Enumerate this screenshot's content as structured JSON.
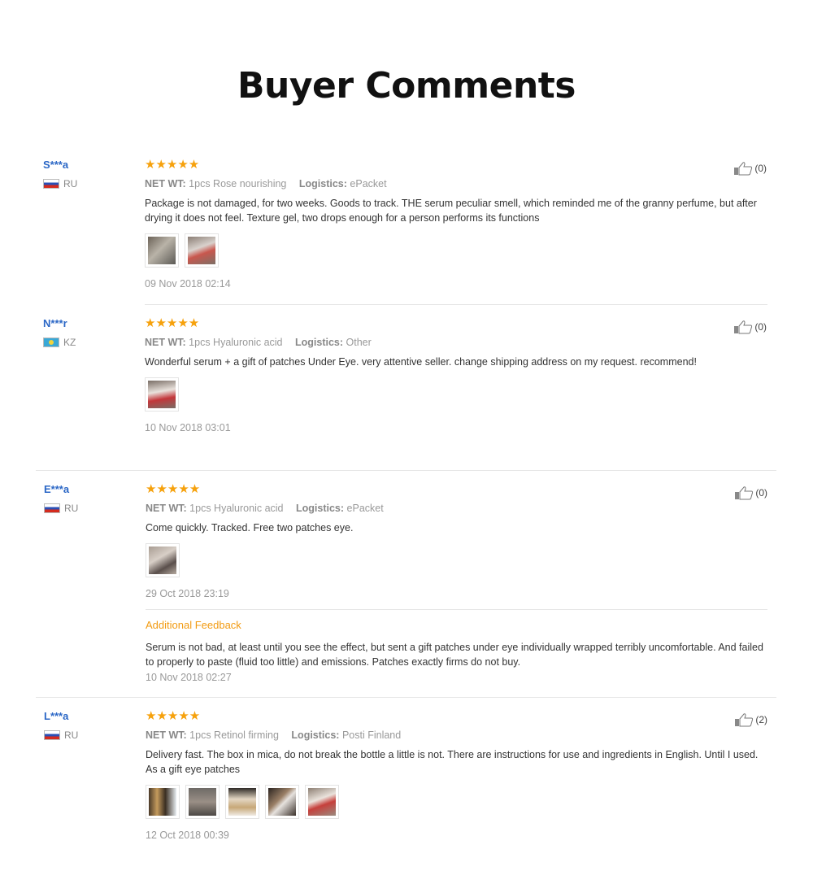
{
  "page": {
    "title": "Buyer Comments"
  },
  "reviews": [
    {
      "buyer": "S***a",
      "country": "RU",
      "stars": "★★★★★",
      "net_wt_label": "NET WT:",
      "net_wt": "1pcs Rose nourishing",
      "logistics_label": "Logistics:",
      "logistics": "ePacket",
      "text": "Package is not damaged, for two weeks. Goods to track. THE serum peculiar smell, which reminded me of the granny perfume, but after drying it does not feel. Texture gel, two drops enough for a person performs its functions",
      "likes": "(0)",
      "date": "09 Nov 2018 02:14",
      "photo_count": 2
    },
    {
      "buyer": "N***r",
      "country": "KZ",
      "stars": "★★★★★",
      "net_wt_label": "NET WT:",
      "net_wt": "1pcs Hyaluronic acid",
      "logistics_label": "Logistics:",
      "logistics": "Other",
      "text": "Wonderful serum + a gift of patches Under Eye. very attentive seller. change shipping address on my request. recommend!",
      "likes": "(0)",
      "date": "10 Nov 2018 03:01",
      "photo_count": 1
    },
    {
      "buyer": "E***a",
      "country": "RU",
      "stars": "★★★★★",
      "net_wt_label": "NET WT:",
      "net_wt": "1pcs Hyaluronic acid",
      "logistics_label": "Logistics:",
      "logistics": "ePacket",
      "text": "Come quickly. Tracked. Free two patches eye.",
      "likes": "(0)",
      "date": "29 Oct 2018 23:19",
      "photo_count": 1,
      "additional": {
        "title": "Additional Feedback",
        "text": "Serum is not bad, at least until you see the effect, but sent a gift patches under eye individually wrapped terribly uncomfortable. And failed to properly to paste (fluid too little) and emissions. Patches exactly firms do not buy.",
        "date": "10 Nov 2018 02:27"
      }
    },
    {
      "buyer": "L***a",
      "country": "RU",
      "stars": "★★★★★",
      "net_wt_label": "NET WT:",
      "net_wt": "1pcs Retinol firming",
      "logistics_label": "Logistics:",
      "logistics": "Posti Finland",
      "text": "Delivery fast. The box in mica, do not break the bottle a little is not. There are instructions for use and ingredients in English. Until I used. As a gift eye patches",
      "likes": "(2)",
      "date": "12 Oct 2018 00:39",
      "photo_count": 5
    }
  ],
  "colors": {
    "buyer_name": "#2b67c6",
    "stars": "#f6a10c",
    "additional_title": "#f29b12",
    "muted_text": "#999999"
  }
}
